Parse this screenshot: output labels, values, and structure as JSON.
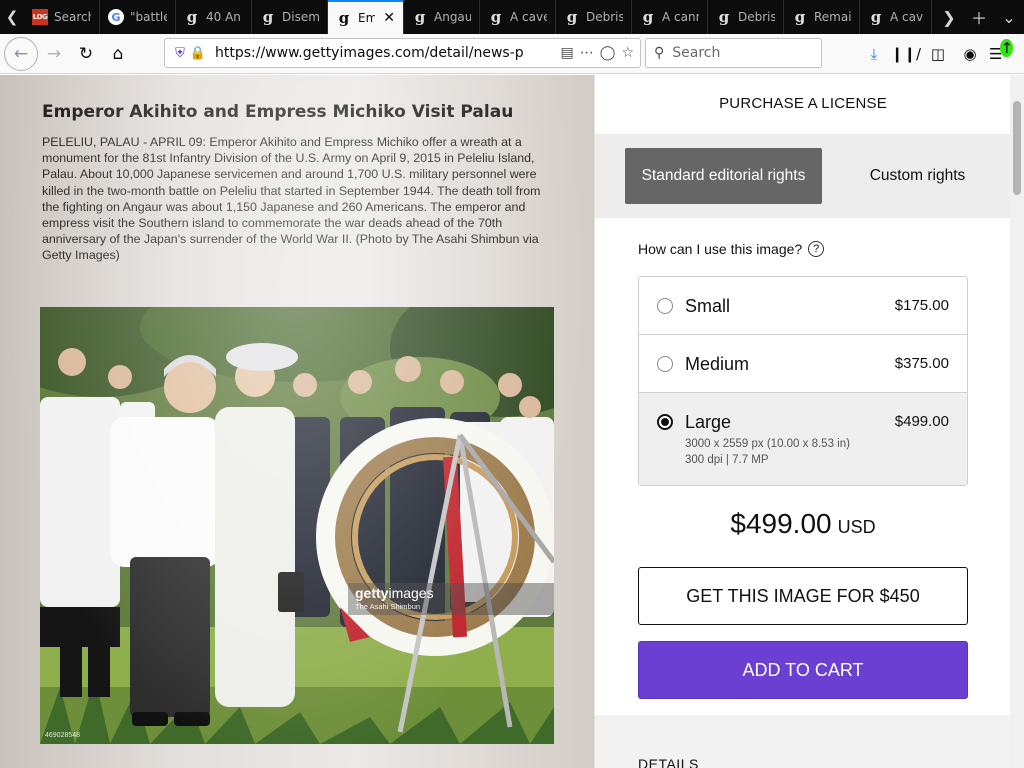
{
  "browser": {
    "tabs": [
      {
        "favicon": "log-icon",
        "title": "Search"
      },
      {
        "favicon": "google-icon",
        "title": "\"battle"
      },
      {
        "favicon": "gettyimages-icon",
        "title": "40 An"
      },
      {
        "favicon": "gettyimages-icon",
        "title": "Disem"
      },
      {
        "favicon": "gettyimages-icon",
        "title": "Em",
        "active": true
      },
      {
        "favicon": "gettyimages-icon",
        "title": "Angau"
      },
      {
        "favicon": "gettyimages-icon",
        "title": "A cave"
      },
      {
        "favicon": "gettyimages-icon",
        "title": "Debris"
      },
      {
        "favicon": "gettyimages-icon",
        "title": "A cann"
      },
      {
        "favicon": "gettyimages-icon",
        "title": "Debris"
      },
      {
        "favicon": "gettyimages-icon",
        "title": "Remai"
      },
      {
        "favicon": "gettyimages-icon",
        "title": "A cave"
      }
    ],
    "url": "https://www.gettyimages.com/detail/news-p",
    "search_placeholder": "Search"
  },
  "image": {
    "title": "Emperor Akihito and Empress Michiko Visit Palau",
    "caption": "PELELIU, PALAU - APRIL 09: Emperor Akihito and Empress Michiko offer a wreath at a monument for the 81st Infantry Division of the U.S. Army on April 9, 2015 in Peleliu Island, Palau. About 10,000 Japanese servicemen and around 1,700 U.S. military personnel were killed in the two-month battle on Peleliu that started in September 1944. The death toll from the fighting on Angaur was about 1,150 Japanese and 260 Americans. The emperor and empress visit the Southern island to commemorate the war deads ahead of the 70th anniversary of the Japan's surrender of the World War II. (Photo by The Asahi Shimbun via Getty Images)",
    "watermark_logo_bold": "getty",
    "watermark_logo_light": "images",
    "watermark_credit": "The Asahi Shimbun",
    "image_id": "469028548"
  },
  "license": {
    "heading": "PURCHASE A LICENSE",
    "rights_standard": "Standard editorial rights",
    "rights_custom": "Custom rights",
    "usage_question": "How can I use this image?",
    "sizes": [
      {
        "name": "Small",
        "price": "$175.00",
        "selected": false
      },
      {
        "name": "Medium",
        "price": "$375.00",
        "selected": false
      },
      {
        "name": "Large",
        "price": "$499.00",
        "selected": true,
        "dimensions": "3000 x 2559 px (10.00 x 8.53 in)",
        "specs": "300 dpi | 7.7 MP"
      }
    ],
    "total_amount": "$499.00",
    "total_currency": "USD",
    "get_image_label": "GET THIS IMAGE FOR $450",
    "add_to_cart_label": "ADD TO CART",
    "details_label": "DETAILS"
  },
  "colors": {
    "accent": "#6a3fd1",
    "selected_rights": "#666666",
    "tab_highlight": "#0a84ff"
  }
}
